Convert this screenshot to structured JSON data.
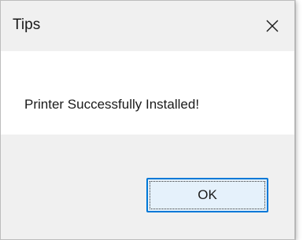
{
  "dialog": {
    "title": "Tips",
    "message": "Printer Successfully Installed!",
    "ok_label": "OK",
    "close_icon": "close-icon"
  },
  "colors": {
    "titlebar_bg": "#f0f0f0",
    "content_bg": "#ffffff",
    "button_border": "#0078d7",
    "button_bg": "#e5f1fb"
  }
}
